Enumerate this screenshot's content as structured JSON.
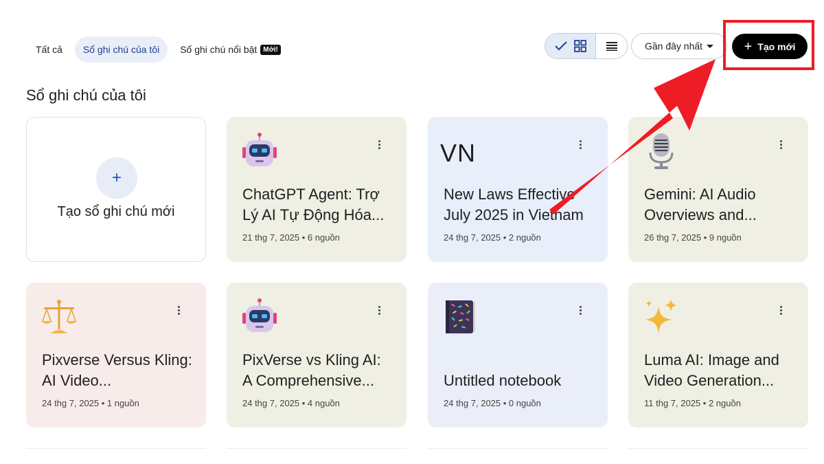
{
  "tabs": [
    {
      "label": "Tất cả",
      "active": false
    },
    {
      "label": "Sổ ghi chú của tôi",
      "active": true
    },
    {
      "label": "Sổ ghi chú nổi bật",
      "active": false,
      "badge": "Mới!"
    }
  ],
  "toolbar": {
    "view_selected": "grid",
    "sort_label": "Gần đây nhất",
    "create_label": "Tạo mới",
    "create_icon": "plus-icon"
  },
  "section_title": "Sổ ghi chú của tôi",
  "new_card": {
    "label": "Tạo sổ ghi chú mới",
    "icon": "+"
  },
  "notebooks": [
    {
      "icon": "robot-icon",
      "title": "ChatGPT Agent: Trợ Lý AI Tự Động Hóa...",
      "meta": "21 thg 7, 2025 • 6 nguồn",
      "bg": "#f0efe4"
    },
    {
      "icon": "text-VN",
      "icon_text": "VN",
      "title": "New Laws Effective July 2025 in Vietnam",
      "meta": "24 thg 7, 2025 • 2 nguồn",
      "bg": "#e8eefa"
    },
    {
      "icon": "microphone-icon",
      "title": "Gemini: AI Audio Overviews and...",
      "meta": "26 thg 7, 2025 • 9 nguồn",
      "bg": "#f0efe4"
    },
    {
      "icon": "scales-icon",
      "title": "Pixverse Versus Kling: AI Video...",
      "meta": "24 thg 7, 2025 • 1 nguồn",
      "bg": "#f8ecea"
    },
    {
      "icon": "robot-icon",
      "title": "PixVerse vs Kling AI: A Comprehensive...",
      "meta": "24 thg 7, 2025 • 4 nguồn",
      "bg": "#f0efe4"
    },
    {
      "icon": "notebook-icon",
      "title": "Untitled notebook",
      "meta": "24 thg 7, 2025 • 0 nguồn",
      "bg": "#eaeef8"
    },
    {
      "icon": "sparkles-icon",
      "title": "Luma AI: Image and Video Generation...",
      "meta": "11 thg 7, 2025 • 2 nguồn",
      "bg": "#f0efe4"
    }
  ],
  "colors": {
    "highlight": "#ee1c25",
    "create_button": "#000000"
  }
}
